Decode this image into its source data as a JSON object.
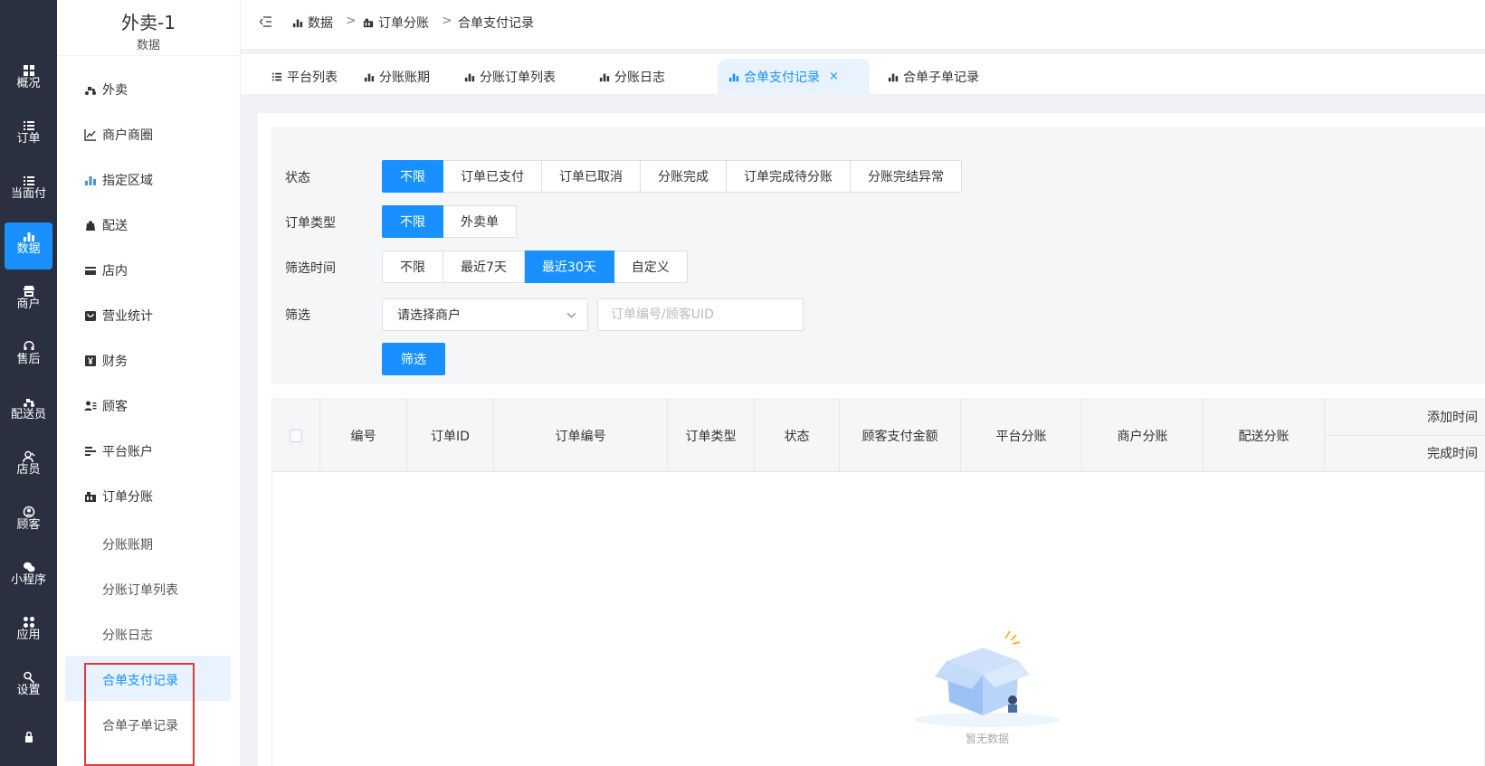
{
  "rail": {
    "items": [
      {
        "label": "概况",
        "icon": "dashboard-icon",
        "active": false
      },
      {
        "label": "订单",
        "icon": "list-icon",
        "active": false
      },
      {
        "label": "当面付",
        "icon": "list-icon",
        "active": false
      },
      {
        "label": "数据",
        "icon": "bar-chart-icon",
        "active": true
      },
      {
        "label": "商户",
        "icon": "store-icon",
        "active": false
      },
      {
        "label": "售后",
        "icon": "headset-icon",
        "active": false
      },
      {
        "label": "配送员",
        "icon": "scooter-icon",
        "active": false
      },
      {
        "label": "店员",
        "icon": "staff-icon",
        "active": false
      },
      {
        "label": "顾客",
        "icon": "user-circle-icon",
        "active": false
      },
      {
        "label": "小程序",
        "icon": "wechat-icon",
        "active": false
      },
      {
        "label": "应用",
        "icon": "apps-icon",
        "active": false
      },
      {
        "label": "设置",
        "icon": "settings-icon",
        "active": false
      }
    ]
  },
  "menu": {
    "title": "外卖-1",
    "subtitle": "数据",
    "items": [
      {
        "label": "外卖",
        "icon": "scooter-icon",
        "expanded": false
      },
      {
        "label": "商户商圈",
        "icon": "line-chart-icon",
        "expanded": false
      },
      {
        "label": "指定区域",
        "icon": "bar-chart-icon",
        "expanded": false
      },
      {
        "label": "配送",
        "icon": "bag-icon",
        "expanded": false
      },
      {
        "label": "店内",
        "icon": "store-icon",
        "expanded": false
      },
      {
        "label": "营业统计",
        "icon": "shop-bag-icon",
        "expanded": false
      },
      {
        "label": "财务",
        "icon": "yen-icon",
        "expanded": false
      },
      {
        "label": "顾客",
        "icon": "user-list-icon",
        "expanded": false
      },
      {
        "label": "平台账户",
        "icon": "align-icon",
        "expanded": false
      },
      {
        "label": "订单分账",
        "icon": "split-icon",
        "expanded": true
      }
    ],
    "sub_items": [
      {
        "label": "分账账期",
        "active": false
      },
      {
        "label": "分账订单列表",
        "active": false
      },
      {
        "label": "分账日志",
        "active": false
      },
      {
        "label": "合单支付记录",
        "active": true
      },
      {
        "label": "合单子单记录",
        "active": false
      }
    ]
  },
  "breadcrumb": [
    "数据",
    "订单分账",
    "合单支付记录"
  ],
  "tabs": [
    {
      "label": "平台列表",
      "icon": "list-icon",
      "active": false
    },
    {
      "label": "分账账期",
      "icon": "bar-chart-icon",
      "active": false
    },
    {
      "label": "分账订单列表",
      "icon": "bar-chart-icon",
      "active": false
    },
    {
      "label": "分账日志",
      "icon": "bar-chart-icon",
      "active": false
    },
    {
      "label": "合单支付记录",
      "icon": "bar-chart-icon",
      "active": true,
      "close": "×"
    },
    {
      "label": "合单子单记录",
      "icon": "bar-chart-icon",
      "active": false
    }
  ],
  "filters": {
    "status": {
      "label": "状态",
      "options": [
        "不限",
        "订单已支付",
        "订单已取消",
        "分账完成",
        "订单完成待分账",
        "分账完结异常"
      ],
      "selected": "不限"
    },
    "order_type": {
      "label": "订单类型",
      "options": [
        "不限",
        "外卖单"
      ],
      "selected": "不限"
    },
    "time": {
      "label": "筛选时间",
      "options": [
        "不限",
        "最近7天",
        "最近30天",
        "自定义"
      ],
      "selected": "最近30天"
    },
    "filter": {
      "label": "筛选",
      "merchant_placeholder": "请选择商户",
      "search_placeholder": "订单编号/顾客UID",
      "submit_label": "筛选"
    }
  },
  "table": {
    "columns": [
      "编号",
      "订单ID",
      "订单编号",
      "订单类型",
      "状态",
      "顾客支付金额",
      "平台分账",
      "商户分账",
      "配送分账"
    ],
    "time_columns": [
      "添加时间",
      "完成时间"
    ],
    "rows": [],
    "empty_text": "暂无数据"
  },
  "colors": {
    "primary": "#1890ff",
    "rail_bg": "#2b3040",
    "highlight_box": "#e4393c"
  }
}
